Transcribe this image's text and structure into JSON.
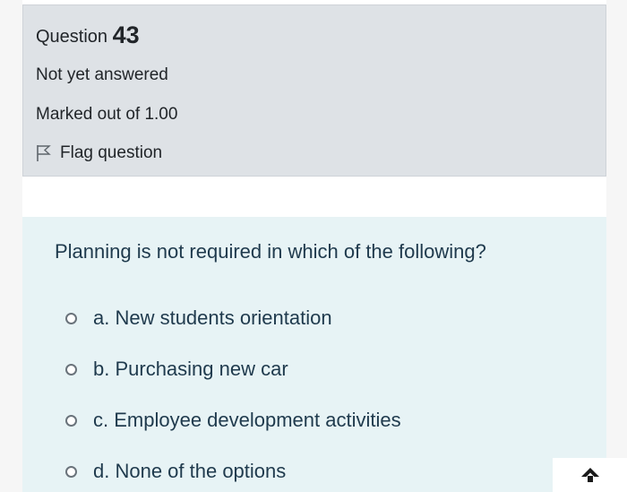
{
  "question_info": {
    "label": "Question",
    "number": "43",
    "status": "Not yet answered",
    "marks": "Marked out of 1.00",
    "flag_label": "Flag question"
  },
  "question": {
    "text": "Planning is not required in which of the following?",
    "options": [
      {
        "label": "a. New students orientation"
      },
      {
        "label": "b. Purchasing new car"
      },
      {
        "label": "c. Employee development activities"
      },
      {
        "label": "d. None of the options"
      }
    ]
  },
  "icons": {
    "flag": "flag-icon",
    "scroll_up": "arrow-up-icon"
  },
  "colors": {
    "info_background": "#dee2e6",
    "question_background": "#e7f3f5",
    "question_text": "#1f3a4d"
  }
}
